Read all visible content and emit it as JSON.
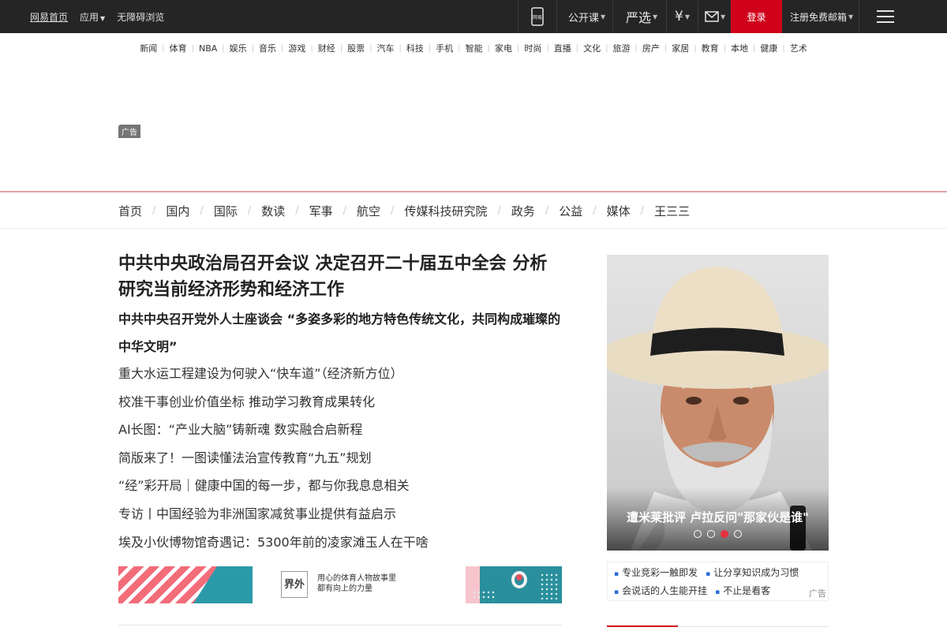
{
  "topbar": {
    "left_links": [
      {
        "label": "网易首页"
      },
      {
        "label": "应用"
      },
      {
        "label": "无障碍浏览"
      }
    ],
    "phone_label": "网易",
    "course_label": "公开课",
    "yanxuan_label": "严选",
    "money_symbol": "¥",
    "login_label": "登录",
    "register_label": "注册免费邮箱",
    "bg_color": "#252525",
    "login_color": "#d0021b"
  },
  "channels": [
    "新闻",
    "体育",
    "NBA",
    "娱乐",
    "音乐",
    "游戏",
    "财经",
    "股票",
    "汽车",
    "科技",
    "手机",
    "智能",
    "家电",
    "时尚",
    "直播",
    "文化",
    "旅游",
    "房产",
    "家居",
    "教育",
    "本地",
    "健康",
    "艺术"
  ],
  "ad": {
    "tag": "广告"
  },
  "section_nav": [
    "首页",
    "国内",
    "国际",
    "数读",
    "军事",
    "航空",
    "传媒科技研究院",
    "政务",
    "公益",
    "媒体",
    "王三三"
  ],
  "main": {
    "headline": "中共中央政治局召开会议 决定召开二十届五中全会 分析研究当前经济形势和经济工作",
    "subhead": "中共中央召开党外人士座谈会 “多姿多彩的地方特色传统文化，共同构成璀璨的中华文明”",
    "news": [
      "重大水运工程建设为何驶入“快车道”（经济新方位）",
      "校准干事创业价值坐标 推动学习教育成果转化",
      "AI长图：“产业大脑”铸新魂 数实融合启新程",
      "简版来了！一图读懂法治宣传教育“九五”规划",
      "“经”彩开局｜健康中国的每一步，都与你我息息相关",
      "专访丨中国经验为非洲国家减贫事业提供有益启示",
      "埃及小伙博物馆奇遇记：5300年前的凌家滩玉人在干啥"
    ],
    "promo": {
      "logo_text": "界外",
      "slogan_line1": "用心的体育人物故事里",
      "slogan_line2": "都有向上的力量"
    }
  },
  "slider": {
    "caption": "遭米莱批评 卢拉反问\"那家伙是谁\"",
    "dot_count": 4,
    "active_dot": 3,
    "accent": "#e6323e"
  },
  "side_ads": {
    "row1": [
      "专业竞彩一触即发",
      "让分享知识成为习惯"
    ],
    "row2": [
      "会说话的人生能开挂",
      "不止是看客"
    ],
    "tag": "广告"
  }
}
